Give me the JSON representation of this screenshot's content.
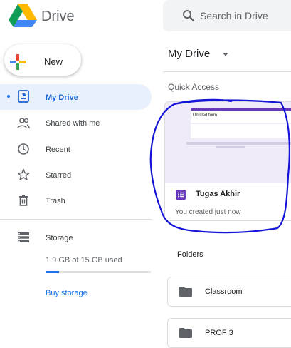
{
  "header": {
    "brand": "Drive",
    "search_placeholder": "Search in Drive"
  },
  "new_button": {
    "label": "New"
  },
  "sidebar": {
    "items": [
      {
        "label": "My Drive",
        "icon": "my-drive-icon",
        "active": true
      },
      {
        "label": "Shared with me",
        "icon": "shared-with-me-icon"
      },
      {
        "label": "Recent",
        "icon": "recent-icon"
      },
      {
        "label": "Starred",
        "icon": "star-icon"
      },
      {
        "label": "Trash",
        "icon": "trash-icon"
      }
    ],
    "storage": {
      "label": "Storage",
      "icon": "storage-icon",
      "used_text": "1.9 GB of 15 GB used",
      "used_fraction": 0.127,
      "buy_label": "Buy storage"
    }
  },
  "main": {
    "title": "My Drive",
    "quick_access": {
      "title": "Quick Access",
      "file": {
        "name": "Tugas Akhir",
        "meta": "You created just now",
        "thumb_title": "Untitled form",
        "icon": "google-forms-icon"
      }
    },
    "folders": {
      "title": "Folders",
      "items": [
        {
          "label": "Classroom",
          "icon": "folder-icon"
        },
        {
          "label": "PROF 3",
          "icon": "folder-icon"
        }
      ]
    }
  },
  "colors": {
    "accent": "#1a73e8",
    "active_bg": "#e8f0fe",
    "forms_purple": "#673ab7",
    "annotation_blue": "#1414d8"
  }
}
